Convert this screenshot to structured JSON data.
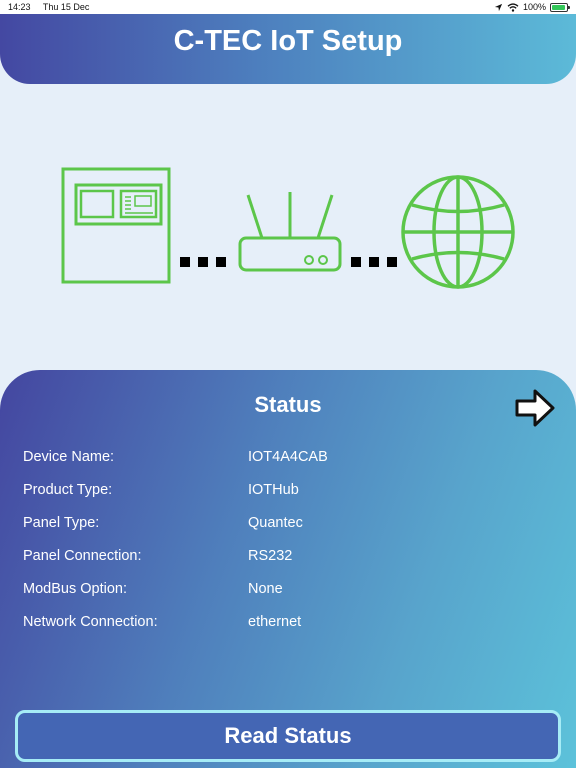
{
  "status_bar": {
    "time": "14:23",
    "date": "Thu 15 Dec",
    "battery": "100%"
  },
  "header": {
    "title": "C-TEC IoT Setup"
  },
  "diagram": {
    "accent_color": "#5cc64a",
    "icons": [
      "fire-panel-icon",
      "router-icon",
      "globe-icon"
    ]
  },
  "status": {
    "title": "Status",
    "rows": [
      {
        "label": "Device Name:",
        "value": "IOT4A4CAB"
      },
      {
        "label": "Product Type:",
        "value": "IOTHub"
      },
      {
        "label": "Panel Type:",
        "value": "Quantec"
      },
      {
        "label": "Panel Connection:",
        "value": "RS232"
      },
      {
        "label": "ModBus Option:",
        "value": "None"
      },
      {
        "label": "Network Connection:",
        "value": "ethernet"
      }
    ]
  },
  "actions": {
    "read_status_label": "Read Status"
  },
  "colors": {
    "background": "#e6eff9",
    "gradient_start": "#4448a2",
    "gradient_end": "#5cbad8",
    "button_fill": "#4466b4",
    "button_border": "#a6ecf6"
  }
}
